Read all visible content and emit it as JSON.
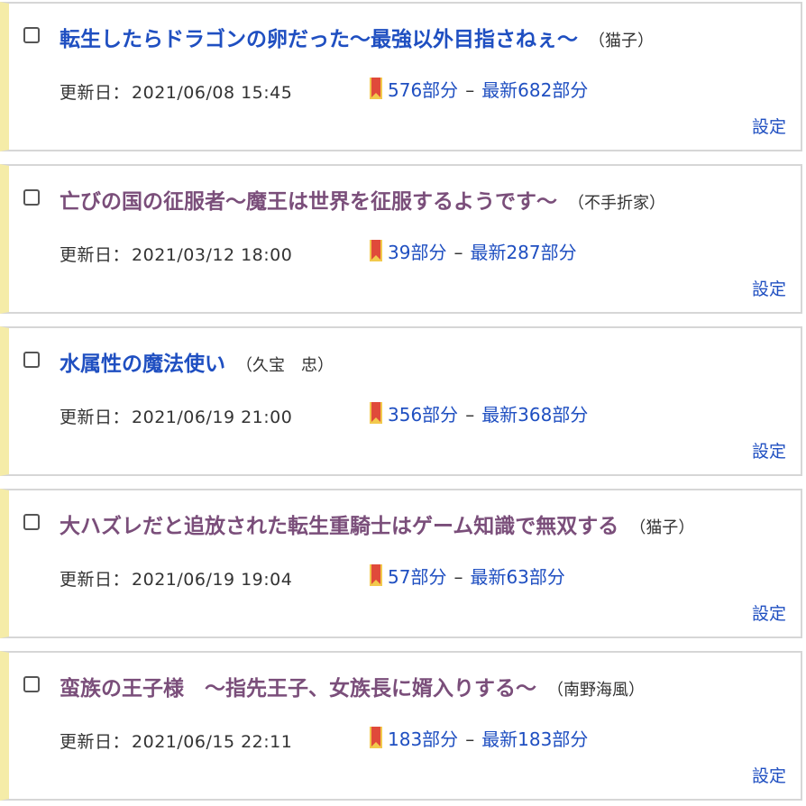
{
  "colors": {
    "link_blue": "#1f4fc1",
    "visited_purple": "#7a4e7a",
    "card_left_bar": "#f5eca8",
    "card_border": "#d6d6d6",
    "bookmark_red": "#e04a3a",
    "bookmark_yellow": "#f2c94c"
  },
  "labels": {
    "updated": "更新日",
    "settings": "設定",
    "dash": "–"
  },
  "items": [
    {
      "title": "転生したらドラゴンの卵だった〜最強以外目指さねぇ〜",
      "author": "猫子",
      "updated": "2021/06/08 15:45",
      "bookmark": "576部分",
      "latest": "最新682部分"
    },
    {
      "title": "亡びの国の征服者〜魔王は世界を征服するようです〜",
      "author": "不手折家",
      "updated": "2021/03/12 18:00",
      "bookmark": "39部分",
      "latest": "最新287部分"
    },
    {
      "title": "水属性の魔法使い",
      "author": "久宝　忠",
      "updated": "2021/06/19 21:00",
      "bookmark": "356部分",
      "latest": "最新368部分"
    },
    {
      "title": "大ハズレだと追放された転生重騎士はゲーム知識で無双する",
      "author": "猫子",
      "updated": "2021/06/19 19:04",
      "bookmark": "57部分",
      "latest": "最新63部分"
    },
    {
      "title": "蛮族の王子様　〜指先王子、女族長に婿入りする〜",
      "author": "南野海風",
      "updated": "2021/06/15 22:11",
      "bookmark": "183部分",
      "latest": "最新183部分"
    }
  ]
}
